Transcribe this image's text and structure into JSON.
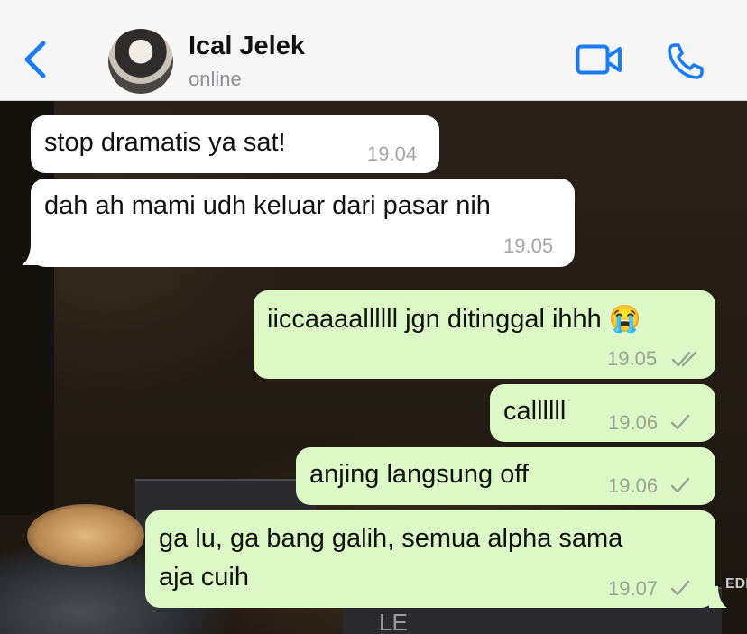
{
  "header": {
    "contact_name": "Ical Jelek",
    "status": "online"
  },
  "messages": [
    {
      "direction": "incoming",
      "text": "stop dramatis ya sat!",
      "time": "19.04"
    },
    {
      "direction": "incoming",
      "text": "dah ah mami udh keluar dari pasar nih",
      "time": "19.05"
    },
    {
      "direction": "outgoing",
      "text": "iiccaaaallllll jgn ditinggal ihhh 😭",
      "time": "19.05",
      "status": "read"
    },
    {
      "direction": "outgoing",
      "text": "callllll",
      "time": "19.06",
      "status": "sent"
    },
    {
      "direction": "outgoing",
      "text": "anjing langsung off",
      "time": "19.06",
      "status": "sent"
    },
    {
      "direction": "outgoing",
      "text_line1": "ga lu, ga bang galih, semua alpha sama",
      "text_line2": "aja cuih",
      "time": "19.07",
      "status": "sent"
    }
  ],
  "wallpaper": {
    "case_label": "LE",
    "edge_text": "EDI"
  },
  "colors": {
    "accent": "#1a7cf5",
    "outgoing_bubble": "#dcf8c6",
    "incoming_bubble": "#ffffff"
  }
}
